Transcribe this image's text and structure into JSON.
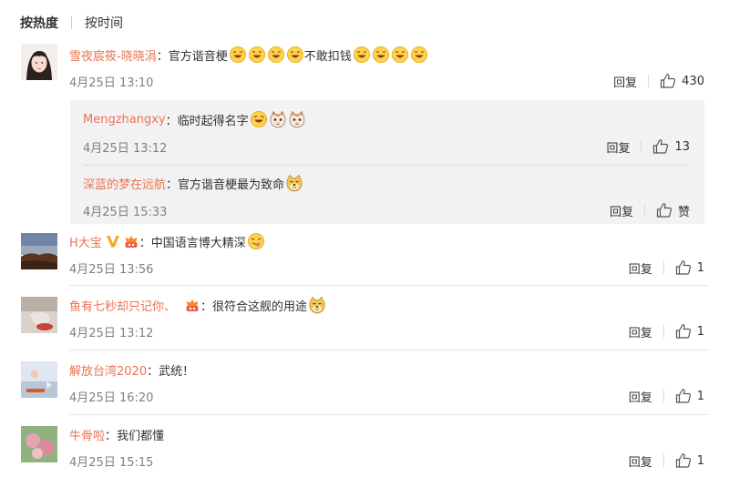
{
  "sort": {
    "hot": "按热度",
    "time": "按时间"
  },
  "comments": [
    {
      "name": "雪夜宸筱-晓晓涓",
      "colon": "：",
      "text_a": "官方谐音梗",
      "text_b": "不敢扣钱",
      "time": "4月25日 13:10",
      "reply": "回复",
      "likes": "430"
    },
    {
      "name": "H大宝",
      "colon": "：",
      "text": "中国语言博大精深",
      "time": "4月25日 13:56",
      "reply": "回复",
      "likes": "1"
    },
    {
      "name": "鱼有七秒却只记你、",
      "colon": "：",
      "text": "很符合这舰的用途",
      "time": "4月25日 13:12",
      "reply": "回复",
      "likes": "1"
    },
    {
      "name": "解放台湾2020",
      "colon": "：",
      "text": "武统！",
      "time": "4月25日 16:20",
      "reply": "回复",
      "likes": "1"
    },
    {
      "name": "牛骨啦",
      "colon": "：",
      "text": "我们都懂",
      "time": "4月25日 15:15",
      "reply": "回复",
      "likes": "1"
    }
  ],
  "replies": [
    {
      "name": "Mengzhangxy",
      "colon": "：",
      "text": "临时起得名字",
      "time": "4月25日 13:12",
      "reply": "回复",
      "likes": "13"
    },
    {
      "name": "深蓝的梦在远航",
      "colon": "：",
      "text": "官方谐音梗最为致命",
      "time": "4月25日 15:33",
      "reply": "回复",
      "likes": "赞"
    }
  ],
  "colors": {
    "name": "#eb7350",
    "time": "#808080",
    "subbox": "#f2f2f5"
  },
  "icons": {
    "like": "thumbs-up-icon",
    "emoji_laugh": "laughing-emoji-icon",
    "emoji_cry_laugh": "tears-of-joy-emoji-icon",
    "emoji_cat": "cat-emoji-icon",
    "emoji_doge": "doge-emoji-icon",
    "emoji_yummy": "yummy-emoji-icon",
    "verified": "orange-v-badge-icon",
    "fan": "fan-badge-icon"
  }
}
